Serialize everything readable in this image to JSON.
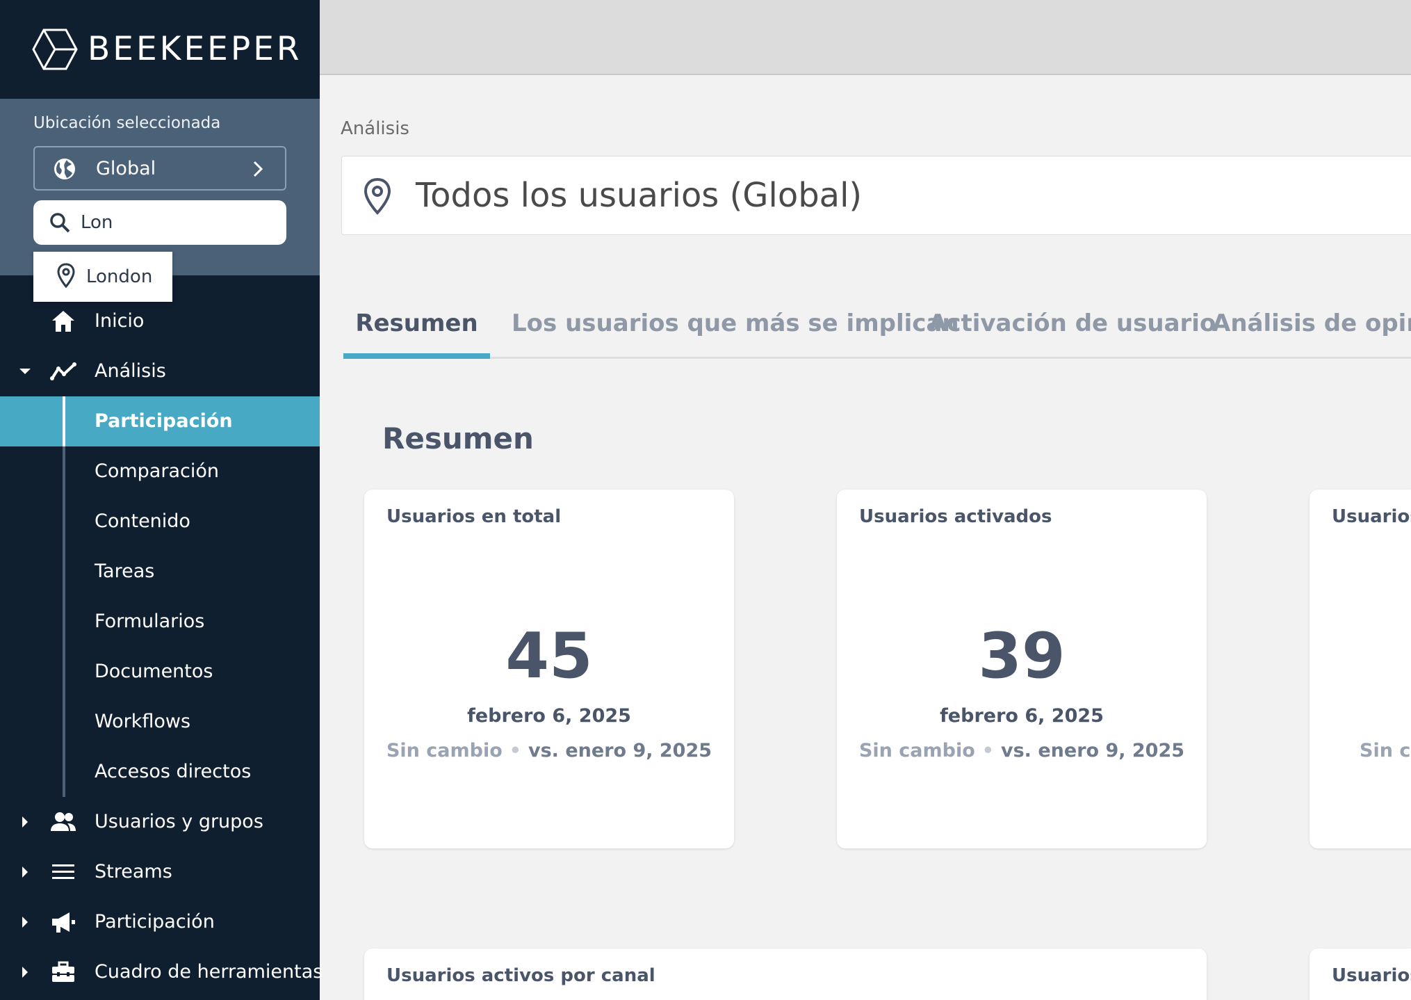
{
  "app": {
    "brand": "BEEKEEPER"
  },
  "location": {
    "label": "Ubicación seleccionada",
    "selected": "Global",
    "search_value": "Lon",
    "suggestion": "London"
  },
  "nav": {
    "inicio": "Inicio",
    "analisis": "Análisis",
    "analisis_sub": [
      "Participación",
      "Comparación",
      "Contenido",
      "Tareas",
      "Formularios",
      "Documentos",
      "Workflows",
      "Accesos directos"
    ],
    "usuarios": "Usuarios y grupos",
    "streams": "Streams",
    "participacion": "Participación",
    "cuadro": "Cuadro de herramientas"
  },
  "main": {
    "breadcrumb": "Análisis",
    "scope_title": "Todos los usuarios (Global)",
    "tabs": [
      "Resumen",
      "Los usuarios que más se implican",
      "Activación de usuario",
      "Análisis de opinió"
    ],
    "section_title": "Resumen",
    "cards": [
      {
        "title": "Usuarios en total",
        "value": "45",
        "date": "febrero 6, 2025",
        "change": "Sin cambio",
        "compare": "vs. enero 9, 2025"
      },
      {
        "title": "Usuarios activados",
        "value": "39",
        "date": "febrero 6, 2025",
        "change": "Sin cambio",
        "compare": "vs. enero 9, 2025"
      },
      {
        "title": "Usuarios",
        "change": "Sin ca"
      }
    ],
    "bottom_cards": [
      "Usuarios activos por canal",
      "Usuarios"
    ]
  },
  "colors": {
    "sidebar": "#101f30",
    "location_panel": "#4b6178",
    "accent": "#47a9c4",
    "text_dark": "#4a556a"
  }
}
